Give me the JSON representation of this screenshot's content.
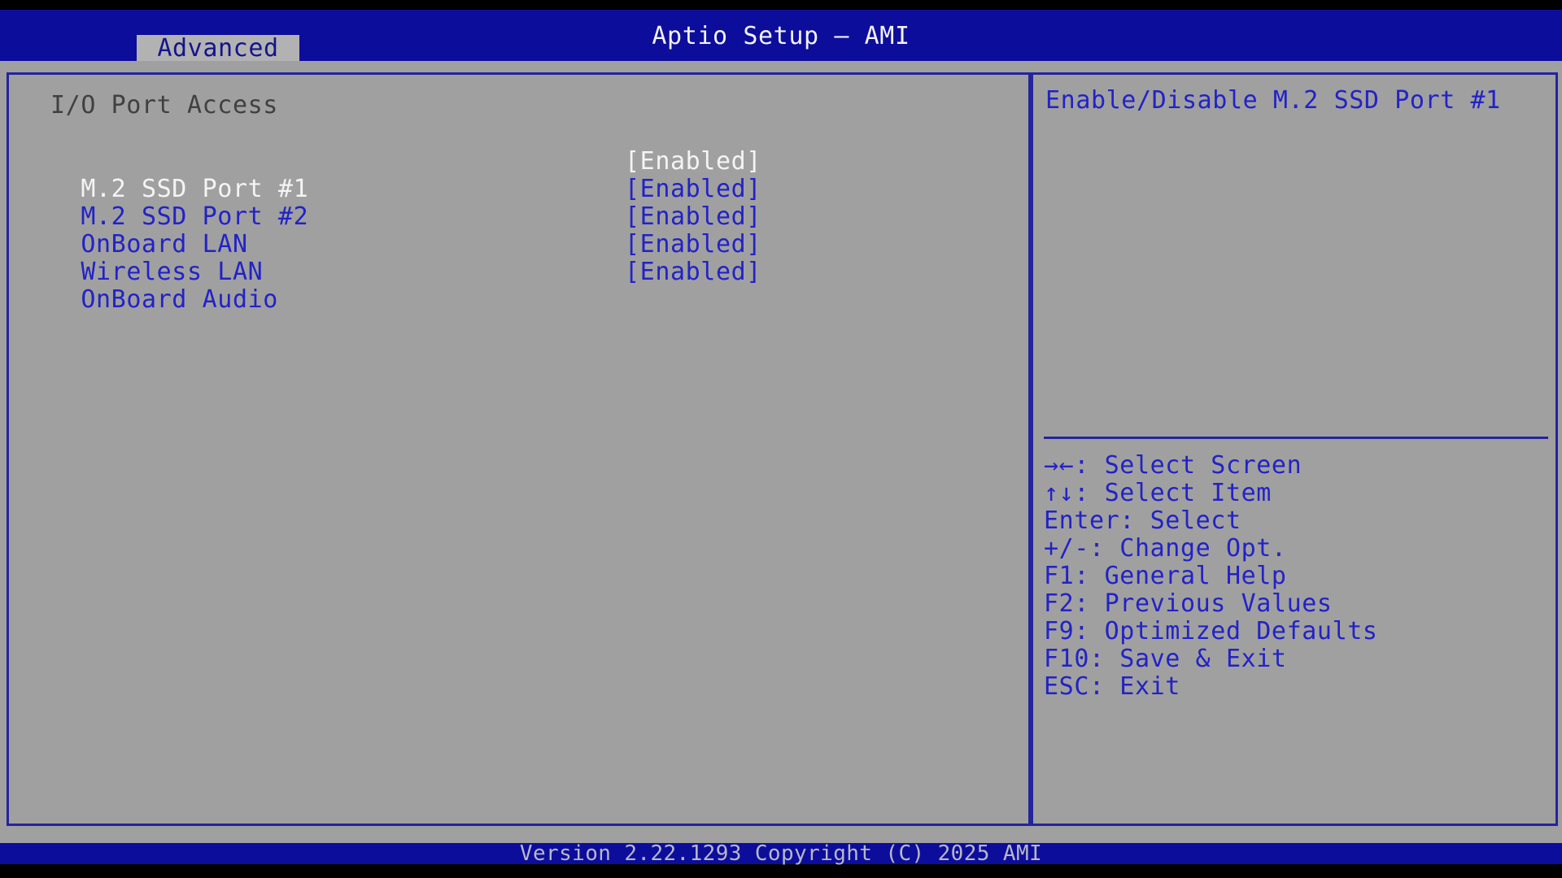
{
  "header": {
    "title": "Aptio Setup – AMI"
  },
  "tabs": {
    "advanced_label": "Advanced"
  },
  "main": {
    "section_title": "I/O Port Access",
    "selected_index": 0,
    "items": [
      {
        "label": "M.2 SSD Port #1",
        "value": "[Enabled]"
      },
      {
        "label": "M.2 SSD Port #2",
        "value": "[Enabled]"
      },
      {
        "label": "OnBoard LAN",
        "value": "[Enabled]"
      },
      {
        "label": "Wireless LAN",
        "value": "[Enabled]"
      },
      {
        "label": "OnBoard Audio",
        "value": "[Enabled]"
      }
    ]
  },
  "help_panel": {
    "description": "Enable/Disable M.2 SSD Port #1",
    "keys": [
      "→←: Select Screen",
      "↑↓: Select Item",
      "Enter: Select",
      "+/-: Change Opt.",
      "F1: General Help",
      "F2: Previous Values",
      "F9: Optimized Defaults",
      "F10: Save & Exit",
      "ESC: Exit"
    ]
  },
  "footer": {
    "version": "Version 2.22.1293 Copyright (C) 2025 AMI"
  },
  "colors": {
    "titlebar_blue": "#0d0d9c",
    "background_gray": "#a0a0a0",
    "tab_gray": "#b2b2b2",
    "border_navy": "#24249c",
    "item_blue": "#2222c8",
    "selected_white": "#f4f4f4",
    "section_text_gray": "#404040",
    "footer_text_gray": "#b8b8c6"
  }
}
